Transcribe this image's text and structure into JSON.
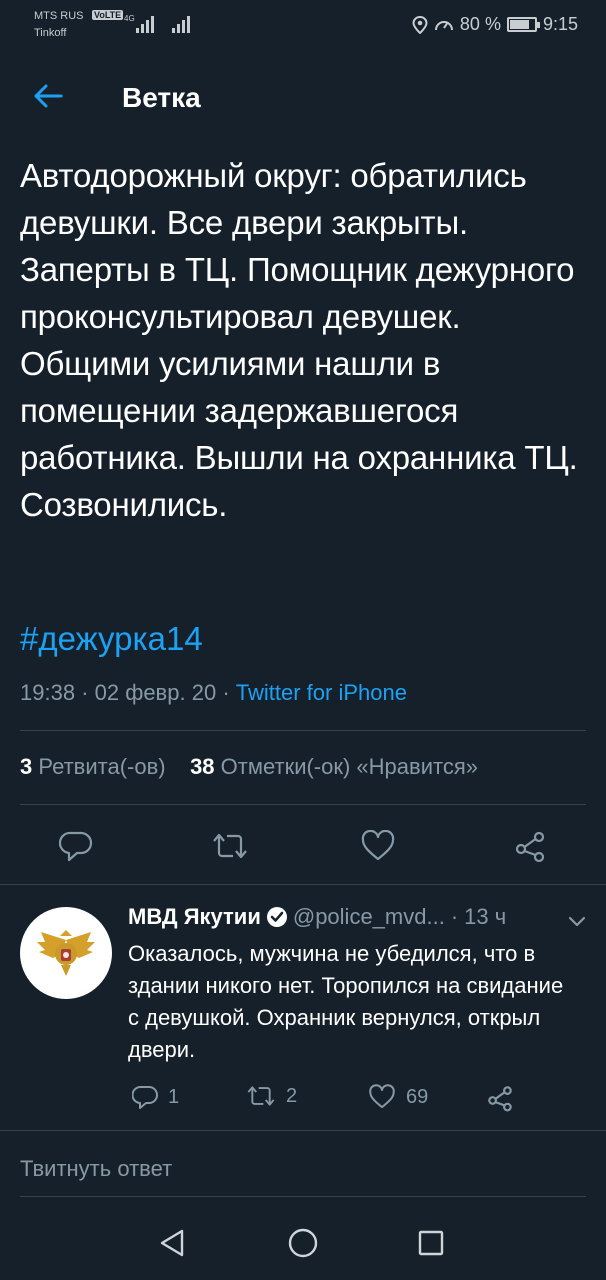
{
  "status_bar": {
    "carrier_1": "MTS RUS",
    "volte": "VoLTE",
    "network": "4G",
    "carrier_2": "Tinkoff",
    "battery_percent": "80 %",
    "battery_level": 0.8,
    "time": "9:15"
  },
  "header": {
    "title": "Ветка",
    "back_icon": "arrow-left-icon"
  },
  "tweet": {
    "text": "Автодорожный округ: обратились девушки. Все двери закрыты. Заперты в ТЦ. Помощник дежурного проконсультировал девушек. Общими усилиями нашли в помещении задержавшегося работника. Вышли на охранника ТЦ. Созвонились.",
    "hashtag": "#дежурка14",
    "time": "19:38",
    "date": "02 февр. 20",
    "source": "Twitter for iPhone",
    "retweets_count": "3",
    "retweets_label": "Ретвита(-ов)",
    "likes_count": "38",
    "likes_label": "Отметки(-ок) «Нравится»",
    "actions": [
      "reply-icon",
      "retweet-icon",
      "like-icon",
      "share-icon"
    ]
  },
  "reply": {
    "author_name": "МВД Якутии",
    "handle": "@police_mvd...",
    "time_ago": "13 ч",
    "text": "Оказалось, мужчина не убедился, что в здании никого нет. Торопился на свидание с девушкой. Охранник вернулся, открыл двери.",
    "reply_count": "1",
    "retweet_count": "2",
    "like_count": "69"
  },
  "compose": {
    "placeholder": "Твитнуть ответ"
  },
  "nav": {
    "icons": [
      "back-triangle-icon",
      "home-circle-icon",
      "recents-square-icon"
    ]
  },
  "colors": {
    "background": "#15202b",
    "accent": "#1da1f2",
    "secondary_text": "#8899a6",
    "divider": "#38444d"
  }
}
